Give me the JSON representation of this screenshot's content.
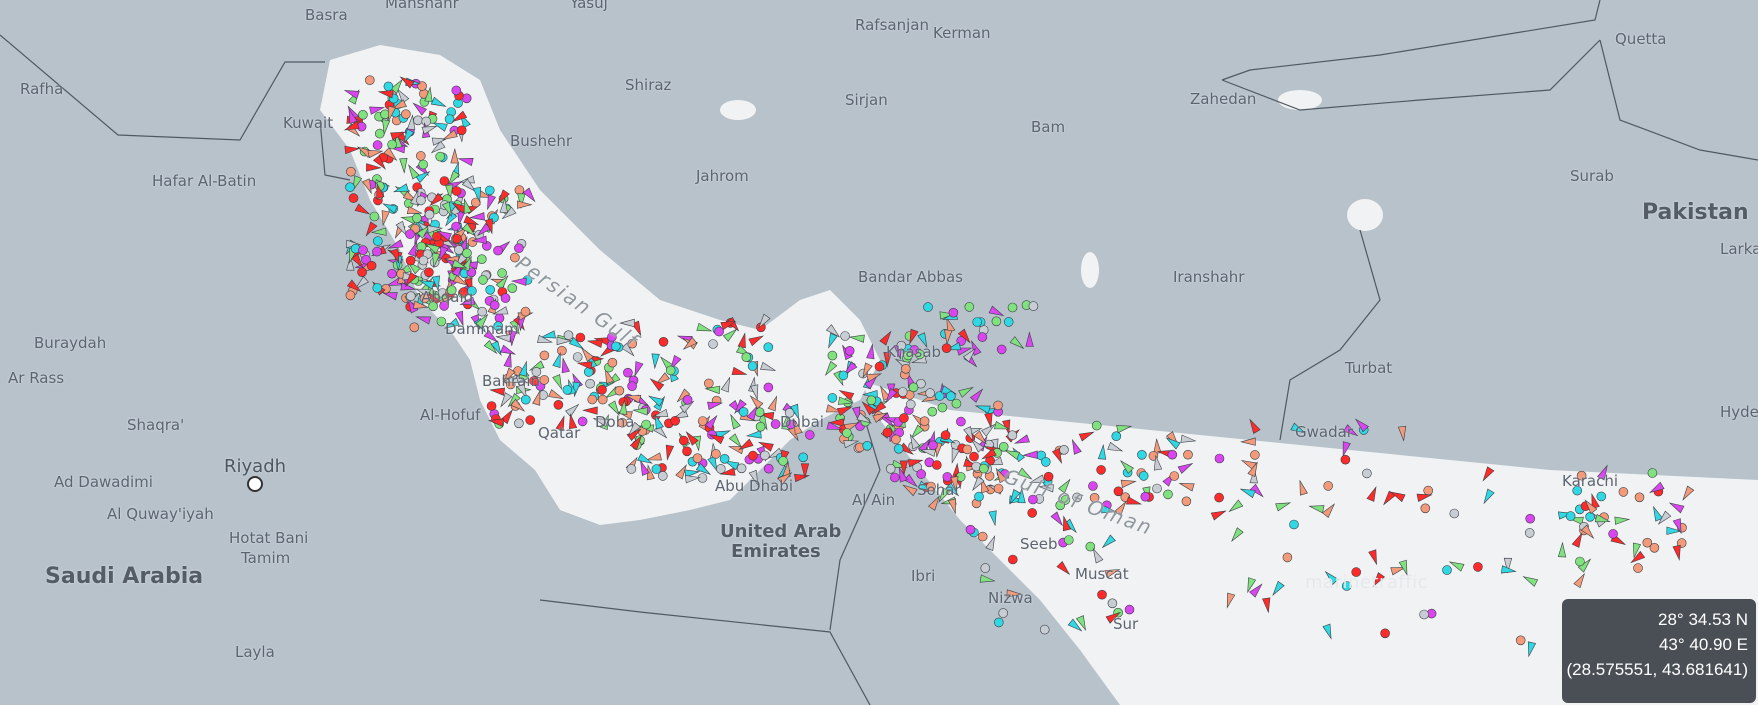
{
  "map": {
    "watermark": "marinetraffic",
    "colors": {
      "water": "#b7c2cb",
      "gulf_sea": "#f1f2f3",
      "land": "#d9dde1",
      "border": "#4f5963",
      "vessel_cargo": "#80e27e",
      "vessel_tanker": "#ff2a2a",
      "vessel_passenger": "#2fd8e3",
      "vessel_tug": "#f29a7a",
      "vessel_pleasure": "#d946ef",
      "vessel_unknown": "#c8cdd3"
    },
    "labels": [
      {
        "text": "Basra",
        "type": "city"
      },
      {
        "text": "Mahshahr",
        "type": "city"
      },
      {
        "text": "Yasuj",
        "type": "city"
      },
      {
        "text": "Rafsanjan",
        "type": "city"
      },
      {
        "text": "Kerman",
        "type": "city"
      },
      {
        "text": "Quetta",
        "type": "city"
      },
      {
        "text": "Rafha",
        "type": "city"
      },
      {
        "text": "Kuwait",
        "type": "city"
      },
      {
        "text": "Shiraz",
        "type": "city"
      },
      {
        "text": "Sirjan",
        "type": "city"
      },
      {
        "text": "Zahedan",
        "type": "city"
      },
      {
        "text": "Bushehr",
        "type": "city"
      },
      {
        "text": "Bam",
        "type": "city"
      },
      {
        "text": "Hafar Al-Batin",
        "type": "city"
      },
      {
        "text": "Jahrom",
        "type": "city"
      },
      {
        "text": "Surab",
        "type": "city"
      },
      {
        "text": "Pakistan",
        "type": "country"
      },
      {
        "text": "Larkana",
        "type": "city"
      },
      {
        "text": "Bandar Abbas",
        "type": "city"
      },
      {
        "text": "Iranshahr",
        "type": "city"
      },
      {
        "text": "Abqaiq",
        "type": "city"
      },
      {
        "text": "Buraydah",
        "type": "city"
      },
      {
        "text": "Dammam",
        "type": "city"
      },
      {
        "text": "Khasab",
        "type": "city"
      },
      {
        "text": "Turbat",
        "type": "city"
      },
      {
        "text": "Ar Rass",
        "type": "city"
      },
      {
        "text": "Bahrain",
        "type": "city"
      },
      {
        "text": "Hyderabad",
        "type": "city"
      },
      {
        "text": "Al-Hofuf",
        "type": "city"
      },
      {
        "text": "Shaqra'",
        "type": "city"
      },
      {
        "text": "Qatar",
        "type": "city"
      },
      {
        "text": "Doha",
        "type": "city"
      },
      {
        "text": "Dubai",
        "type": "city"
      },
      {
        "text": "Gwadar",
        "type": "city"
      },
      {
        "text": "Riyadh",
        "type": "capital"
      },
      {
        "text": "Karachi",
        "type": "city"
      },
      {
        "text": "Ad Dawadimi",
        "type": "city"
      },
      {
        "text": "Abu Dhabi",
        "type": "city"
      },
      {
        "text": "Al Ain",
        "type": "city"
      },
      {
        "text": "Sohar",
        "type": "city"
      },
      {
        "text": "Al Quway'iyah",
        "type": "city"
      },
      {
        "text": "United Arab",
        "type": "country-small"
      },
      {
        "text": "Emirates",
        "type": "country-small"
      },
      {
        "text": "Seeb",
        "type": "city"
      },
      {
        "text": "Hotat Bani",
        "type": "city"
      },
      {
        "text": "Tamim",
        "type": "city"
      },
      {
        "text": "Muscat",
        "type": "city"
      },
      {
        "text": "Saudi Arabia",
        "type": "country"
      },
      {
        "text": "Ibri",
        "type": "city"
      },
      {
        "text": "Nizwa",
        "type": "city"
      },
      {
        "text": "Sur",
        "type": "city"
      },
      {
        "text": "Layla",
        "type": "city"
      },
      {
        "text": "Persian Gulf",
        "type": "sea"
      },
      {
        "text": "Gulf of Oman",
        "type": "sea"
      }
    ]
  },
  "coordinates": {
    "lat": "28° 34.53 N",
    "lon": "43° 40.90 E",
    "decimal": "(28.575551, 43.681641)"
  }
}
